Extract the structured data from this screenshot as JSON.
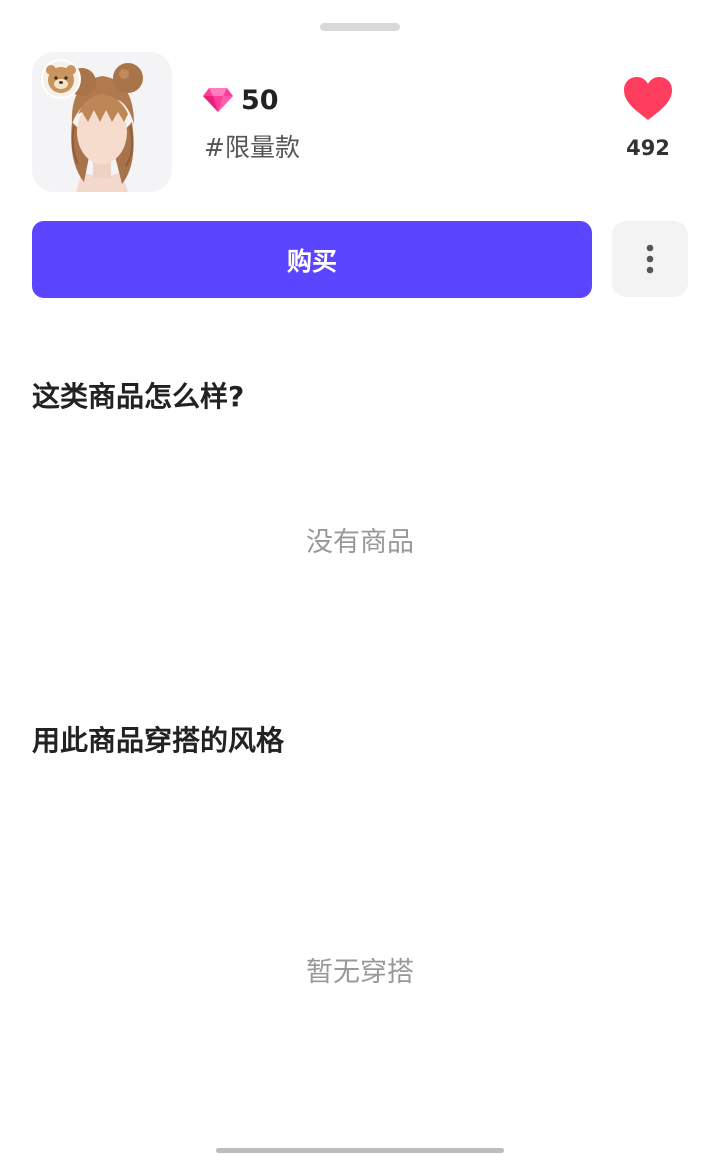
{
  "item": {
    "price": "50",
    "currency_icon": "gem-icon",
    "tag": "#限量款",
    "likes": "492",
    "like_icon": "heart-icon",
    "thumbnail": "hairstyle-thumbnail",
    "badge_icon": "bear-badge-icon"
  },
  "actions": {
    "buy_label": "购买",
    "more_icon": "more-vertical-icon"
  },
  "sections": {
    "similar_title": "这类商品怎么样?",
    "similar_empty": "没有商品",
    "outfit_title": "用此商品穿搭的风格",
    "outfit_empty": "暂无穿搭"
  },
  "colors": {
    "accent": "#5c45ff",
    "heart": "#ff3d5e",
    "gem": "#ff3d9a"
  }
}
